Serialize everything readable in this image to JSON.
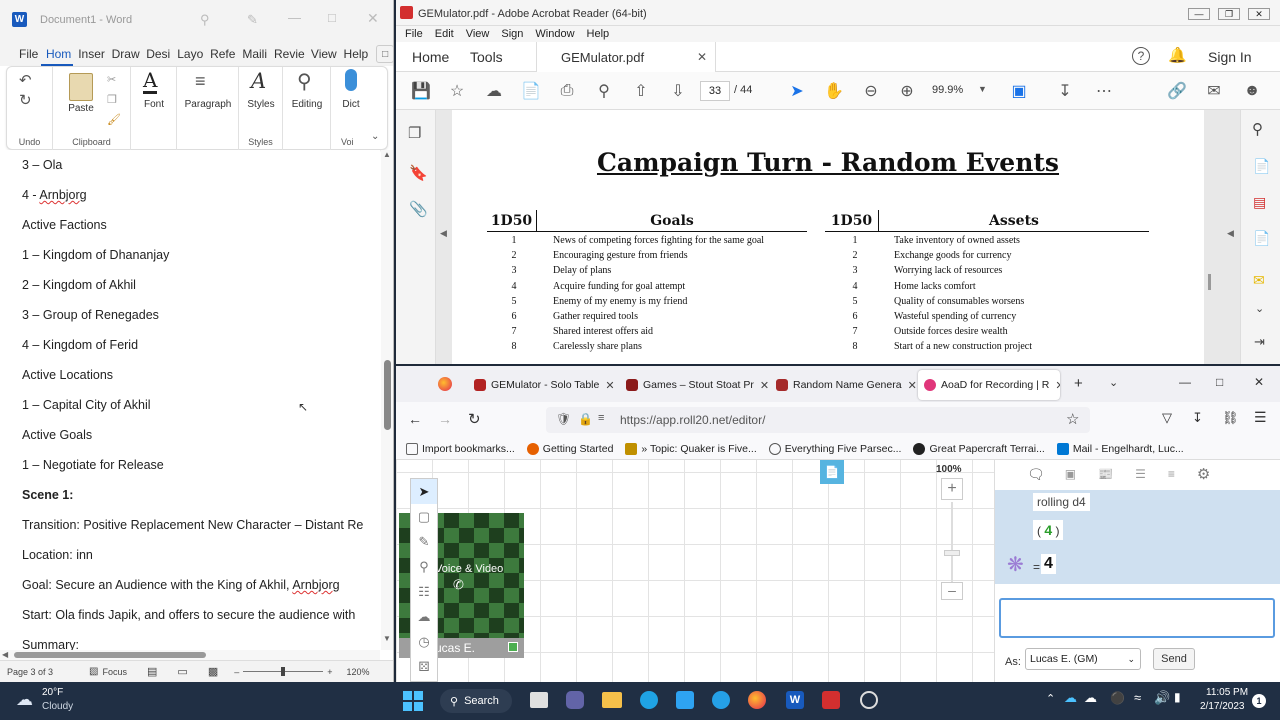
{
  "word": {
    "title": "Document1 - Word",
    "tabs": [
      "File",
      "Hom",
      "Inser",
      "Draw",
      "Desi",
      "Layo",
      "Refe",
      "Maili",
      "Revie",
      "View",
      "Help"
    ],
    "ribbon": {
      "undo_label": "Undo",
      "paste_label": "Paste",
      "clipboard_label": "Clipboard",
      "font_label": "Font",
      "paragraph_label": "Paragraph",
      "styles_label": "Styles",
      "styles_group_label": "Styles",
      "editing_label": "Editing",
      "dictate_label": "Dict",
      "voice_label": "Voi"
    },
    "paragraphs": [
      "3 – Ola",
      "4 - Arnbjorg",
      "Active Factions",
      "1 – Kingdom of Dhananjay",
      "2 – Kingdom of Akhil",
      "3 – Group of Renegades",
      "4 – Kingdom of Ferid",
      "Active Locations",
      "1 – Capital City of Akhil",
      "Active Goals",
      "1 – Negotiate for Release",
      "Scene 1:",
      "Transition: Positive Replacement New Character – Distant Re",
      "Location: inn",
      "Goal: Secure an Audience with the King of Akhil, Arnbjorg",
      "Start: Ola finds Japik, and offers to secure the audience with",
      "Summary:"
    ],
    "status": {
      "page": "Page 3 of 3",
      "focus": "Focus",
      "zoom": "120%"
    }
  },
  "acrobat": {
    "title": "GEMulator.pdf - Adobe Acrobat Reader (64-bit)",
    "menu": [
      "File",
      "Edit",
      "View",
      "Sign",
      "Window",
      "Help"
    ],
    "home_tab": "Home",
    "tools_tab": "Tools",
    "doc_tab": "GEMulator.pdf",
    "sign_in": "Sign In",
    "page_current": "33",
    "page_total": "/ 44",
    "zoom": "99.9%",
    "pdf": {
      "heading": "Campaign Turn - Random Events",
      "goals_die": "1D50",
      "goals_header": "Goals",
      "assets_die": "1D50",
      "assets_header": "Assets",
      "goals": [
        {
          "n": "1",
          "text": "News of competing forces fighting for the same goal"
        },
        {
          "n": "2",
          "text": "Encouraging gesture from friends"
        },
        {
          "n": "3",
          "text": "Delay of plans"
        },
        {
          "n": "4",
          "text": "Acquire funding for goal attempt"
        },
        {
          "n": "5",
          "text": "Enemy of my enemy is my friend"
        },
        {
          "n": "6",
          "text": "Gather required tools"
        },
        {
          "n": "7",
          "text": "Shared interest offers aid"
        },
        {
          "n": "8",
          "text": "Carelessly share plans"
        }
      ],
      "assets": [
        {
          "n": "1",
          "text": "Take inventory of owned assets"
        },
        {
          "n": "2",
          "text": "Exchange goods for currency"
        },
        {
          "n": "3",
          "text": "Worrying lack of resources"
        },
        {
          "n": "4",
          "text": "Home lacks comfort"
        },
        {
          "n": "5",
          "text": "Quality of consumables worsens"
        },
        {
          "n": "6",
          "text": "Wasteful spending of currency"
        },
        {
          "n": "7",
          "text": "Outside forces desire wealth"
        },
        {
          "n": "8",
          "text": "Start of a new construction project"
        }
      ]
    }
  },
  "firefox": {
    "tabs": [
      {
        "label": "GEMulator - Solo Table",
        "color": "#b22222"
      },
      {
        "label": "Games – Stout Stoat Pr",
        "color": "#8b1a1a"
      },
      {
        "label": "Random Name Genera",
        "color": "#a52a2a"
      },
      {
        "label": "AoaD for Recording | R",
        "color": "#e0367a"
      }
    ],
    "url": "https://app.roll20.net/editor/",
    "bookmarks": [
      {
        "label": "Import bookmarks...",
        "color": "#666"
      },
      {
        "label": "Getting Started",
        "color": "#e66000"
      },
      {
        "label": "» Topic: Quaker is Five...",
        "color": "#c09000"
      },
      {
        "label": "Everything Five Parsec...",
        "color": "#555"
      },
      {
        "label": "Great Papercraft Terrai...",
        "color": "#222"
      },
      {
        "label": "Mail - Engelhardt, Luc...",
        "color": "#0078d4"
      }
    ],
    "roll20": {
      "zoom": "100%",
      "voice_video": "Voice & Video",
      "player_name": "ucas E.",
      "chat_roll_label": "rolling d4",
      "chat_die_value": "4",
      "chat_total_prefix": "=",
      "chat_total": "4",
      "as_label": "As:",
      "as_value": "Lucas E. (GM)",
      "send_label": "Send"
    }
  },
  "taskbar": {
    "weather_temp": "20°F",
    "weather_desc": "Cloudy",
    "search_label": "Search",
    "time": "11:05 PM",
    "date": "2/17/2023",
    "notif_count": "1"
  }
}
